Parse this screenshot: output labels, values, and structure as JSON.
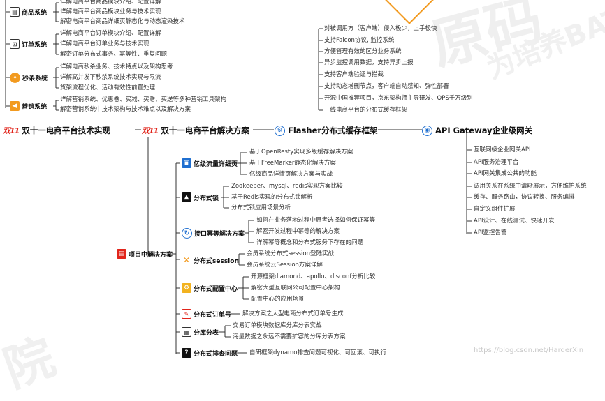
{
  "watermarks": {
    "big": "原码",
    "slogan": "为培养BAT",
    "small": "院",
    "footer": "https://blog.csdn.net/HarderXin"
  },
  "top_left": {
    "commodity": {
      "label": "商品系统",
      "items": [
        "详解电商平台商品模块介绍、配置详解",
        "详解电商平台商品模块业务与技术实现",
        "解密电商平台商品详细页静态化与动态渲染技术"
      ]
    },
    "order": {
      "label": "订单系统",
      "items": [
        "详解电商平台订单模块介绍、配置详解",
        "详解电商平台订单业务与技术实现",
        "解密订单分布式事务、幂等性、重复问题"
      ]
    },
    "seckill": {
      "label": "秒杀系统",
      "items": [
        "详解电商秒杀业务、技术特点以及架构思考",
        "详解高并发下秒杀系统技术实现与限流",
        "货架流程优化、活动有效性前置处理"
      ]
    },
    "marketing": {
      "label": "营销系统",
      "items": [
        "详解营销系统、优惠卷、买减、买赠、买送等多种营销工具架构",
        "解密营销系统中技术架构与技术难点以及解决方案"
      ]
    }
  },
  "spine": {
    "tech_impl": "双十一电商平台技术实现",
    "solutions": "双十一电商平台解决方案",
    "flasher": "Flasher分布式缓存框架",
    "gateway": "API Gateway企业级网关",
    "double_eleven_logo": "双11"
  },
  "flasher_items": [
    "对被调用方（客户端）侵入极少，上手极快",
    "支持Falcon协议, 监控系统",
    "方便管理有效的区分业务系统",
    "异步监控调用数据，支持异步上报",
    "支持客户端验证与拦截",
    "支持动态增删节点，客户端自动感知、弹性部署",
    "开源中国推荐项目，京东架构师主导研发、QPS千万级别",
    "一线电商平台的分布式缓存框架"
  ],
  "gateway_items": [
    "互联网级企业网关API",
    "API服务治理平台",
    "API网关集成公共的功能",
    "调用关系在系统中清晰展示，方便维护系统",
    "缓存、服务路由，协议转换、服务编排",
    "自定义组件扩展",
    "API设计、在线测试、快速开发",
    "API监控告警"
  ],
  "project": {
    "label": "项目中解决方案",
    "branches": [
      {
        "label": "亿级流量详细页",
        "items": [
          "基于OpenResty实现多级缓存解决方案",
          "基于FreeMarker静态化解决方案",
          "亿级商品详情页解决方案与实战"
        ]
      },
      {
        "label": "分布式锁",
        "items": [
          "Zookeeper、mysql、redis实现方案比较",
          "基于Redis实现的分布式锁解析",
          "分布式锁应用场景分析"
        ]
      },
      {
        "label": "接口幂等解决方案",
        "items": [
          "如何在业务落地过程中思考选择如何保证幂等",
          "解密开发过程中幂等的解决方案",
          "详解幂等概念和分布式服务下存在的问题"
        ]
      },
      {
        "label": "分布式session",
        "items": [
          "会员系统分布式session登陆实战",
          "会员系统云Session方案详解"
        ]
      },
      {
        "label": "分布式配置中心",
        "items": [
          "开源框架diamond、apollo、disconf分析比较",
          "解密大型互联网公司配置中心架构",
          "配置中心的应用场景"
        ]
      },
      {
        "label": "分布式订单号",
        "items": [
          "解决方案之大型电商分布式订单号生成"
        ]
      },
      {
        "label": "分库分表",
        "items": [
          "交易订单模块数据库分库分表实战",
          "海量数据之永远不需要扩容的分库分表方案"
        ]
      },
      {
        "label": "分布式排查问题",
        "items": [
          "自研框架dynamo排查问题可视化、可回滚、可执行"
        ]
      }
    ]
  },
  "colors": {
    "line": "#222222",
    "accent_red": "#e1251b",
    "accent_blue": "#1f6fd0",
    "orange": "#f29a1f"
  }
}
